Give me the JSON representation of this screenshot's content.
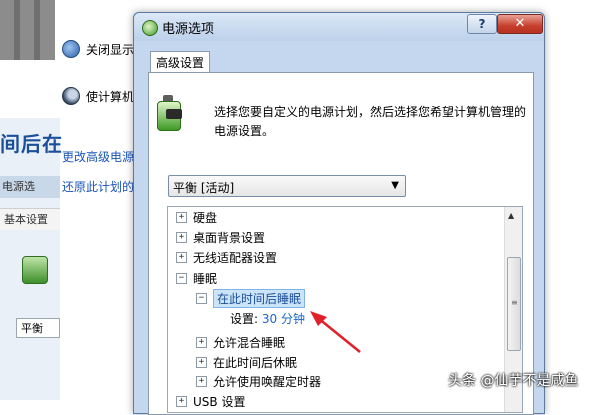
{
  "background": {
    "items": [
      {
        "label": "关闭显示",
        "icon": "monitor-icon"
      },
      {
        "label": "使计算机",
        "icon": "moon-icon"
      }
    ],
    "links": [
      "更改高级电源",
      "还原此计划的"
    ],
    "big_title": "间后在",
    "tab_partial": "电源选",
    "subtab_partial": "基本设置",
    "combo_partial": "平衡"
  },
  "dialog": {
    "title": "电源选项",
    "help_label": "?",
    "close_label": "✕",
    "tab_label": "高级设置",
    "description": "选择您要自定义的电源计划，然后选择您希望计算机管理的电源设置。",
    "plan_select": {
      "value": "平衡 [活动]"
    },
    "tree": [
      {
        "label": "硬盘",
        "expander": "+",
        "level": 0
      },
      {
        "label": "桌面背景设置",
        "expander": "+",
        "level": 0
      },
      {
        "label": "无线适配器设置",
        "expander": "+",
        "level": 0
      },
      {
        "label": "睡眠",
        "expander": "−",
        "level": 0
      },
      {
        "label": "在此时间后睡眠",
        "expander": "−",
        "level": 1,
        "selected": true
      },
      {
        "label": "允许混合睡眠",
        "expander": "+",
        "level": 1
      },
      {
        "label": "在此时间后休眠",
        "expander": "+",
        "level": 1
      },
      {
        "label": "允许使用唤醒定时器",
        "expander": "+",
        "level": 1
      },
      {
        "label": "USB 设置",
        "expander": "+",
        "level": 0
      }
    ],
    "setting": {
      "label": "设置:",
      "value": "30 分钟"
    }
  },
  "watermark": "头条 @仙芋不是咸鱼",
  "colors": {
    "accent_link": "#1a55b8",
    "selection": "#cce4f7",
    "annotation_arrow": "#e0202a"
  }
}
